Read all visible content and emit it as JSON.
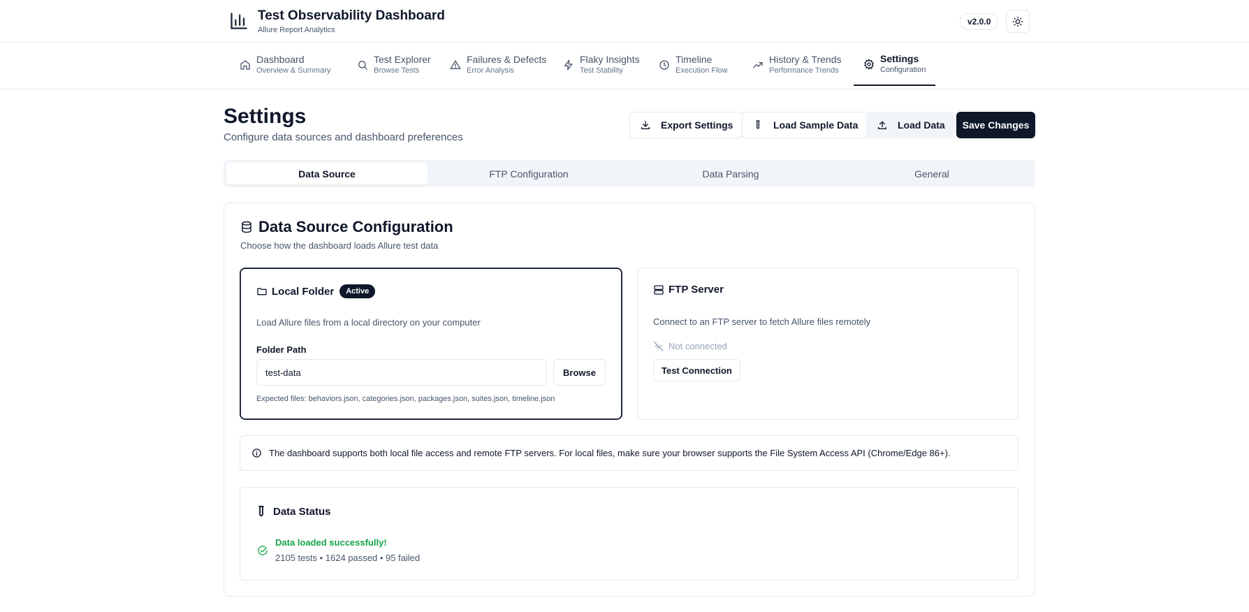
{
  "header": {
    "title": "Test Observability Dashboard",
    "subtitle": "Allure Report Analytics",
    "version": "v2.0.0",
    "logo_icon": "bar-chart-icon",
    "theme_icon": "sun-icon"
  },
  "nav": {
    "items": [
      {
        "label": "Dashboard",
        "sub": "Overview & Summary",
        "icon": "home-icon"
      },
      {
        "label": "Test Explorer",
        "sub": "Browse Tests",
        "icon": "search-icon"
      },
      {
        "label": "Failures & Defects",
        "sub": "Error Analysis",
        "icon": "warning-triangle-icon"
      },
      {
        "label": "Flaky Insights",
        "sub": "Test Stability",
        "icon": "lightning-icon"
      },
      {
        "label": "Timeline",
        "sub": "Execution Flow",
        "icon": "clock-icon"
      },
      {
        "label": "History & Trends",
        "sub": "Performance Trends",
        "icon": "trending-up-icon"
      },
      {
        "label": "Settings",
        "sub": "Configuration",
        "icon": "gear-icon",
        "active": true
      }
    ]
  },
  "page": {
    "title": "Settings",
    "subtitle": "Configure data sources and dashboard preferences"
  },
  "actions": {
    "export": "Export Settings",
    "load_sample": "Load Sample Data",
    "load_data": "Load Data",
    "save": "Save Changes"
  },
  "tabs": [
    {
      "label": "Data Source",
      "active": true
    },
    {
      "label": "FTP Configuration"
    },
    {
      "label": "Data Parsing"
    },
    {
      "label": "General"
    }
  ],
  "data_source": {
    "title": "Data Source Configuration",
    "description": "Choose how the dashboard loads Allure test data",
    "local": {
      "name": "Local Folder",
      "badge": "Active",
      "description": "Load Allure files from a local directory on your computer",
      "field_label": "Folder Path",
      "folder_value": "test-data",
      "browse_label": "Browse",
      "hint": "Expected files: behaviors.json, categories.json, packages.json, suites.json, timeline.json"
    },
    "ftp": {
      "name": "FTP Server",
      "description": "Connect to an FTP server to fetch Allure files remotely",
      "status": "Not connected",
      "test_button": "Test Connection"
    },
    "info": "The dashboard supports both local file access and remote FTP servers. For local files, make sure your browser supports the File System Access API (Chrome/Edge 86+).",
    "status": {
      "title": "Data Status",
      "message": "Data loaded successfully!",
      "detail": "2105 tests • 1624 passed • 95 failed"
    }
  },
  "colors": {
    "primary": "#0f172a",
    "success": "#16a34a",
    "muted_text": "#475569",
    "border": "#e5e7eb",
    "tab_bg": "#f1f5f9"
  }
}
